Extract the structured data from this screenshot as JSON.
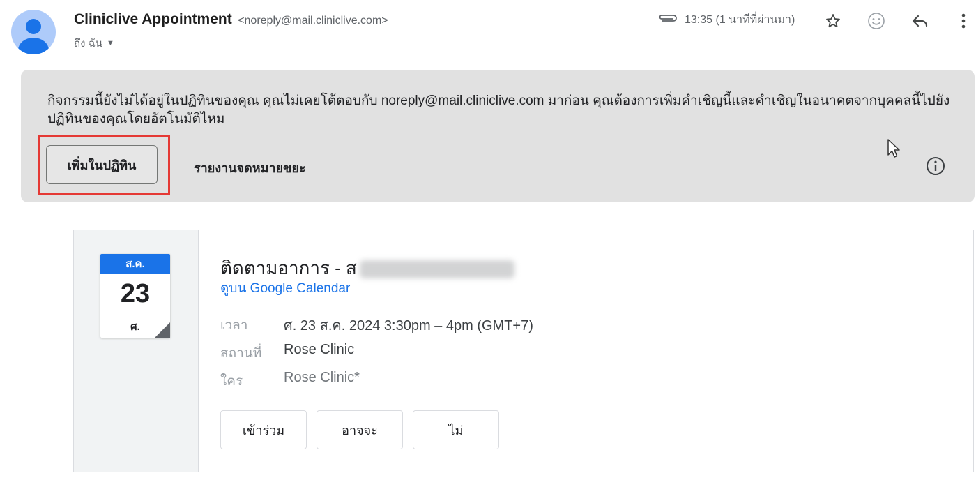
{
  "email": {
    "sender_name": "Cliniclive Appointment",
    "sender_email": "<noreply@mail.cliniclive.com>",
    "to_label": "ถึง ฉัน",
    "time": "13:35 (1 นาทีที่ผ่านมา)"
  },
  "icons": {
    "avatar": "person-avatar",
    "attachment": "paperclip-icon",
    "star": "star-icon",
    "emoji": "emoji-icon",
    "reply": "reply-icon",
    "more": "more-vert-icon",
    "info": "info-icon",
    "cursor": "mouse-pointer"
  },
  "banner": {
    "text": "กิจกรรมนี้ยังไม่ได้อยู่ในปฏิทินของคุณ คุณไม่เคยโต้ตอบกับ noreply@mail.cliniclive.com มาก่อน คุณต้องการเพิ่มคำเชิญนี้และคำเชิญในอนาคตจากบุคคลนี้ไปยังปฏิทินของคุณโดยอัตโนมัติไหม",
    "add_button": "เพิ่มในปฏิทิน",
    "report_spam": "รายงานจดหมายขยะ"
  },
  "invite": {
    "calendar_month": "ส.ค.",
    "calendar_day": "23",
    "calendar_weekday": "ศ.",
    "title": "ติดตามอาการ - ส",
    "calendar_link": "ดูบน Google Calendar",
    "time_label": "เวลา",
    "time_value": "ศ. 23 ส.ค. 2024 3:30pm – 4pm (GMT+7)",
    "location_label": "สถานที่",
    "location_value": "Rose Clinic",
    "who_label": "ใคร",
    "who_value": "Rose Clinic*",
    "rsvp_yes": "เข้าร่วม",
    "rsvp_maybe": "อาจจะ",
    "rsvp_no": "ไม่"
  },
  "colors": {
    "accent_blue": "#1a73e8",
    "banner_bg": "#e1e1e1",
    "highlight_red": "#e53935"
  }
}
